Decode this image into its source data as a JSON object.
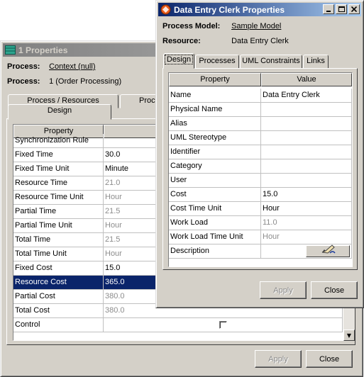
{
  "back_window": {
    "title": "1 Properties",
    "process_label": "Process:",
    "process_link": "Context (null)",
    "process2_label": "Process:",
    "process2_value": "1 (Order Processing)",
    "tabs_row1": [
      "Process / Resources",
      "Proc"
    ],
    "tabs_row2": [
      "Design"
    ],
    "grid_header": {
      "property": "Property",
      "value": ""
    },
    "rows": [
      {
        "p": "Synchronization Rule",
        "v": ""
      },
      {
        "p": "Fixed Time",
        "v": "30.0"
      },
      {
        "p": "Fixed Time Unit",
        "v": "Minute"
      },
      {
        "p": "Resource Time",
        "v": "21.0",
        "dim": true
      },
      {
        "p": "Resource Time Unit",
        "v": "Hour",
        "dim": true
      },
      {
        "p": "Partial Time",
        "v": "21.5",
        "dim": true
      },
      {
        "p": "Partial Time Unit",
        "v": "Hour",
        "dim": true
      },
      {
        "p": "Total Time",
        "v": "21.5",
        "dim": true
      },
      {
        "p": "Total Time Unit",
        "v": "Hour",
        "dim": true
      },
      {
        "p": "Fixed Cost",
        "v": "15.0"
      },
      {
        "p": "Resource Cost",
        "v": "365.0",
        "selected": true
      },
      {
        "p": "Partial Cost",
        "v": "380.0",
        "dim": true
      },
      {
        "p": "Total Cost",
        "v": "380.0",
        "dim": true
      },
      {
        "p": "Control",
        "v": "",
        "checkbox": true,
        "checked": false
      }
    ],
    "apply_label": "Apply",
    "close_label": "Close"
  },
  "front_window": {
    "title": "Data Entry Clerk Properties",
    "process_model_label": "Process Model:",
    "process_model_link": "Sample Model",
    "resource_label": "Resource:",
    "resource_value": "Data Entry Clerk",
    "tabs": [
      "Design",
      "Processes",
      "UML Constraints",
      "Links"
    ],
    "selected_tab": "Design",
    "grid_header": {
      "property": "Property",
      "value": "Value"
    },
    "rows": [
      {
        "p": "Name",
        "v": "Data Entry Clerk"
      },
      {
        "p": "Physical Name",
        "v": ""
      },
      {
        "p": "Alias",
        "v": ""
      },
      {
        "p": "UML Stereotype",
        "v": ""
      },
      {
        "p": "Identifier",
        "v": ""
      },
      {
        "p": "Category",
        "v": ""
      },
      {
        "p": "User",
        "v": ""
      },
      {
        "p": "Cost",
        "v": "15.0"
      },
      {
        "p": "Cost Time Unit",
        "v": "Hour"
      },
      {
        "p": "Work Load",
        "v": "11.0",
        "dim": true
      },
      {
        "p": "Work Load Time Unit",
        "v": "Hour",
        "dim": true
      },
      {
        "p": "Description",
        "v": "",
        "edit_button": true
      }
    ],
    "apply_label": "Apply",
    "close_label": "Close"
  },
  "icons": {
    "back_app": "table-window-icon",
    "front_app": "resource-properties-icon",
    "description_editor": "pencil-edit-icon"
  },
  "colors": {
    "active_title": "#0a246a",
    "inactive_title": "#808080",
    "selection": "#0a246a",
    "face": "#d4d0c8"
  }
}
